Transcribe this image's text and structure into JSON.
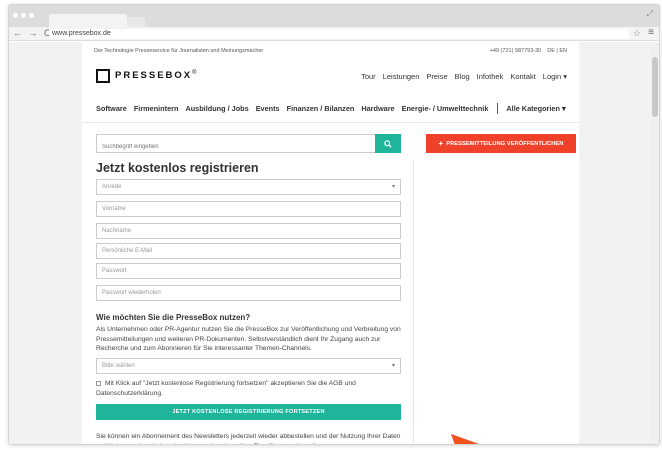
{
  "browser": {
    "url": "www.pressebox.de",
    "nav_buttons": "← → C",
    "star": "☆",
    "menu": "≡",
    "resize": "⤢"
  },
  "header": {
    "tagline": "Der Technologie Presseservice für Journalisten und Meinungsmacher",
    "phone": "+49 (721) 987793-30",
    "lang": "DE | EN",
    "logo_text": "PRESSEBOX",
    "logo_sup": "®",
    "main_nav": [
      "Tour",
      "Leistungen",
      "Preise",
      "Blog",
      "Infothek",
      "Kontakt",
      "Login ▾"
    ]
  },
  "categories": [
    "Software",
    "Firmenintern",
    "Ausbildung / Jobs",
    "Events",
    "Finanzen / Bilanzen",
    "Hardware",
    "Energie- / Umwelttechnik"
  ],
  "all_categories": "Alle Kategorien ▾",
  "search": {
    "placeholder": "Suchbegriff eingeben",
    "icon": "🔍"
  },
  "publish_button": {
    "plus": "+",
    "label": "PRESSEMITTEILUNG VERÖFFENTLICHEN"
  },
  "form": {
    "title": "Jetzt kostenlos registrieren",
    "salutation": "Anrede",
    "firstname": "Vorname",
    "lastname": "Nachname",
    "email": "Persönliche E-Mail",
    "password": "Passwort",
    "password_repeat": "Passwort wiederholen",
    "usage_title": "Wie möchten Sie die PresseBox nutzen?",
    "usage_text": "Als Unternehmen oder PR-Agentur nutzen Sie die PresseBox zur Veröffentlichung und Verbreitung von Pressemitteilungen und weiteren PR-Dokumenten. Selbstverständlich dient Ihr Zugang auch zur Recherche und zum Abonnieren für Sie interessanter Themen-Channels.",
    "usage_select": "Bitte wählen",
    "chevron": "▾",
    "consent": "Mit Klick auf \"Jetzt kostenlose Registrierung fortsetzen\" akzeptieren Sie die AGB und Datenschutzerklärung.",
    "submit": "JETZT KOSTENLOSE REGISTRIERUNG FORTSETZEN",
    "footer_text": "Sie können ein Abonnement des Newsletters jederzeit wieder abbestellen und der Nutzung Ihrer Daten zu Werbezwecken jederzeit widersprechen bzw. Ihre Einwilligung widerrufen."
  },
  "colors": {
    "green": "#1fb59a",
    "red": "#f0422b",
    "cursor": "#f0521e"
  }
}
